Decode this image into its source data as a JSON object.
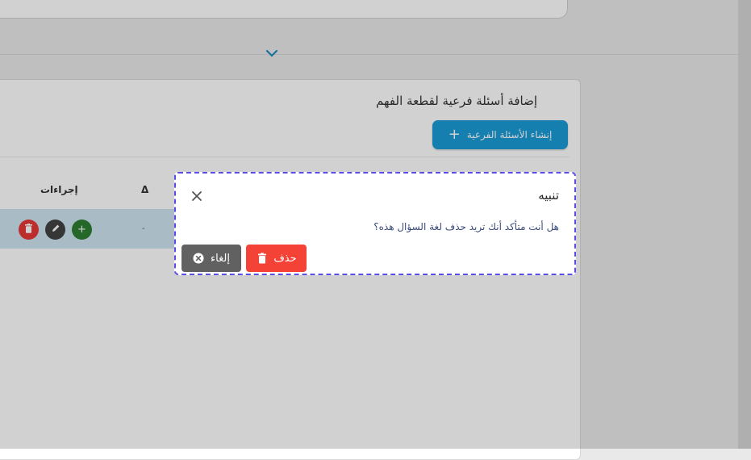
{
  "page": {
    "card_title": "إضافة أسئلة فرعية لقطعة الفهم",
    "create_button_label": "إنشاء الأسئلة الفرعية",
    "create_button_icon": "plus-icon"
  },
  "table": {
    "headers": {
      "actions": "إجراءات",
      "delta": "Δ"
    },
    "row": {
      "value": "-",
      "actions": [
        "delete-icon",
        "edit-icon",
        "plus-icon"
      ]
    }
  },
  "dialog": {
    "title": "تنبيه",
    "message": "هل أنت متأكد أنك تريد حذف لغة السؤال هذه؟",
    "delete_label": "حذف",
    "cancel_label": "إلغاء"
  },
  "colors": {
    "accent": "#1a9cd6",
    "danger": "#f44336",
    "neutral": "#616161",
    "success": "#2e7d32",
    "focus_outline": "#5b4ee6"
  }
}
